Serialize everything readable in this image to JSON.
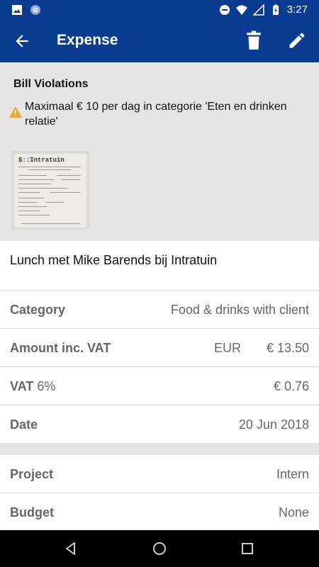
{
  "status_bar": {
    "time": "3:27",
    "icons": [
      "image-icon",
      "circle-icon",
      "dnd-icon",
      "wifi-icon",
      "signal-icon",
      "battery-icon"
    ]
  },
  "app_bar": {
    "title": "Expense",
    "icons": [
      "back-arrow-icon",
      "trash-icon",
      "edit-icon"
    ]
  },
  "violations": {
    "title": "Bill Violations",
    "message": "Maximaal € 10 per dag in categorie 'Eten en drinken relatie'",
    "warning_color": "#f5a623"
  },
  "receipt": {
    "header": "$::Intratuin"
  },
  "expense": {
    "description": "Lunch met Mike Barends bij Intratuin",
    "category_label": "Category",
    "category_value": "Food & drinks with client",
    "amount_label": "Amount inc. VAT",
    "amount_currency": "EUR",
    "amount_value": "€ 13.50",
    "vat_label": "VAT",
    "vat_rate": "6%",
    "vat_value": "€ 0.76",
    "date_label": "Date",
    "date_value": "20 Jun 2018",
    "project_label": "Project",
    "project_value": "Intern",
    "budget_label": "Budget",
    "budget_value": "None"
  },
  "colors": {
    "primary": "#0a3d91",
    "section_bg": "#e5e5e5"
  },
  "nav_bar": {
    "icons": [
      "back-triangle-icon",
      "home-circle-icon",
      "recents-square-icon"
    ]
  }
}
